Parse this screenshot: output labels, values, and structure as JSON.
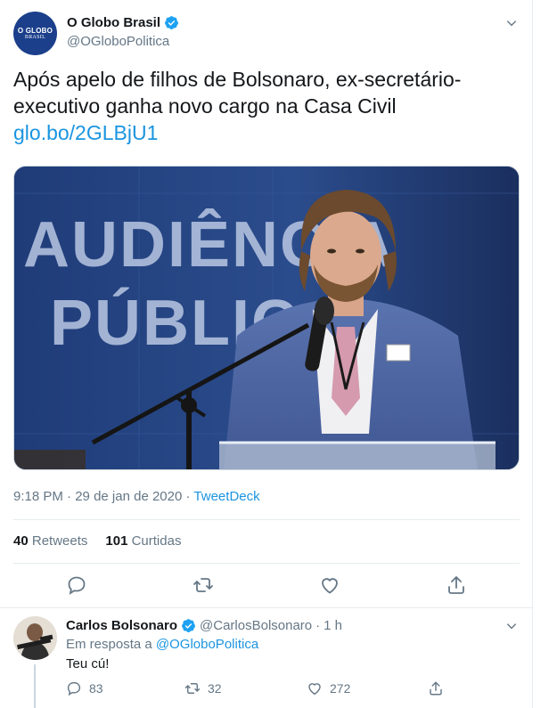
{
  "tweet": {
    "author": {
      "name": "O Globo Brasil",
      "handle": "@OGloboPolitica",
      "avatar_logo_top": "O GLOBO",
      "avatar_logo_bottom": "BRASIL",
      "verified": true
    },
    "text": "Após apelo de filhos de Bolsonaro, ex-secretário-executivo ganha novo cargo na Casa Civil",
    "link": "glo.bo/2GLBjU1",
    "media": {
      "banner_line1": "AUDIÊNCIA",
      "banner_line2": "PÚBLICA"
    },
    "time": "9:18 PM",
    "date": "29 de jan de 2020",
    "separator": "·",
    "source": "TweetDeck",
    "stats": {
      "retweets_count": "40",
      "retweets_label": "Retweets",
      "likes_count": "101",
      "likes_label": "Curtidas"
    },
    "actions": [
      "reply-icon",
      "retweet-icon",
      "like-icon",
      "share-icon"
    ]
  },
  "reply": {
    "author": {
      "name": "Carlos Bolsonaro",
      "handle": "@CarlosBolsonaro",
      "separator": "·",
      "time": "1 h",
      "verified": true
    },
    "in_reply_prefix": "Em resposta a",
    "in_reply_mention": "@OGloboPolitica",
    "text": "Teu cú!",
    "replies": "83",
    "retweets": "32",
    "likes": "272"
  },
  "colors": {
    "accent": "#1b95e0",
    "muted": "#657786",
    "text": "#14171a",
    "divider": "#e6ecf0"
  }
}
